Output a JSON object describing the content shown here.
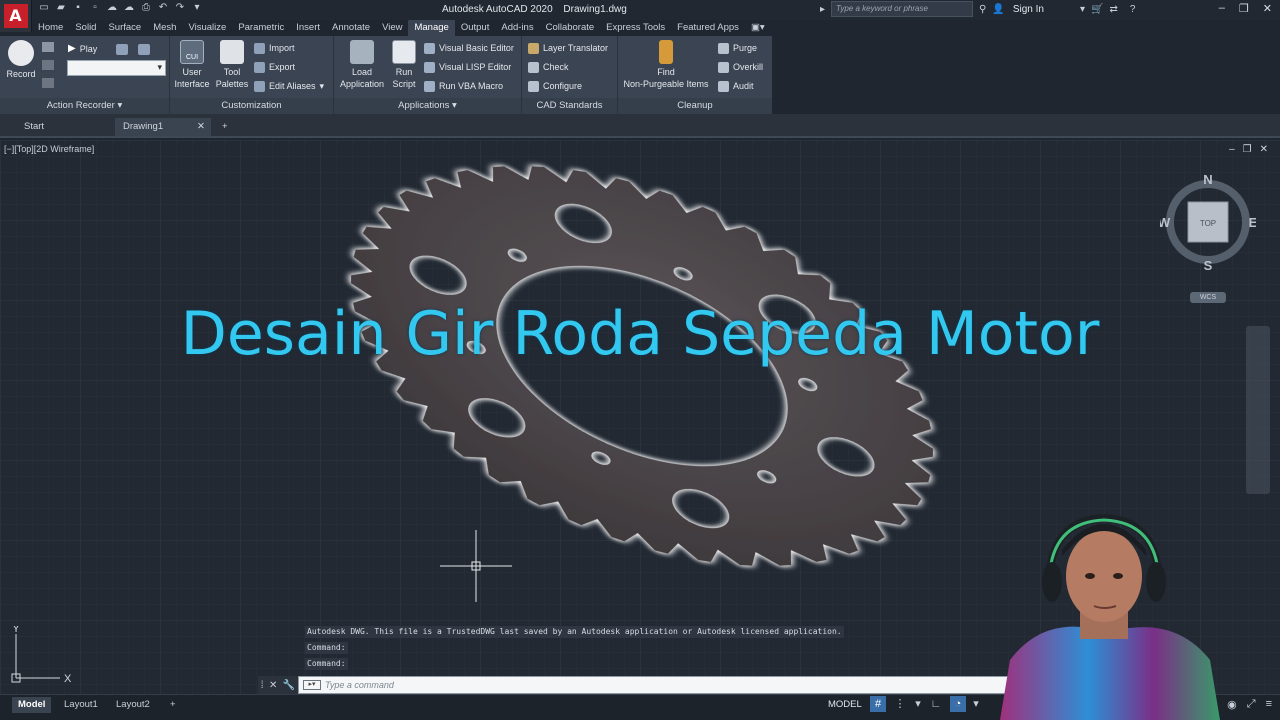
{
  "titlebar": {
    "app_name": "Autodesk AutoCAD 2020",
    "file_name": "Drawing1.dwg",
    "search_placeholder": "Type a keyword or phrase",
    "signin_label": "Sign In",
    "logo_letter": "A"
  },
  "ribbon_tabs": [
    "Home",
    "Solid",
    "Surface",
    "Mesh",
    "Visualize",
    "Parametric",
    "Insert",
    "Annotate",
    "View",
    "Manage",
    "Output",
    "Add-ins",
    "Collaborate",
    "Express Tools",
    "Featured Apps"
  ],
  "active_tab": "Manage",
  "ribbon": {
    "action_recorder": {
      "title": "Action Recorder",
      "record": "Record",
      "play": "Play"
    },
    "customization": {
      "title": "Customization",
      "user_interface": [
        "User",
        "Interface"
      ],
      "tool_palettes": [
        "Tool",
        "Palettes"
      ],
      "import": "Import",
      "export": "Export",
      "edit_aliases": "Edit Aliases"
    },
    "applications": {
      "title": "Applications",
      "load_application": [
        "Load",
        "Application"
      ],
      "run_script": [
        "Run",
        "Script"
      ],
      "visual_basic_editor": "Visual Basic Editor",
      "visual_lisp_editor": "Visual LISP Editor",
      "run_vba_macro": "Run VBA Macro"
    },
    "cad_standards": {
      "title": "CAD Standards",
      "layer_translator": "Layer Translator",
      "check": "Check",
      "configure": "Configure"
    },
    "cleanup": {
      "title": "Cleanup",
      "find_non_purgeable": [
        "Find",
        "Non-Purgeable Items"
      ],
      "purge": "Purge",
      "overkill": "Overkill",
      "audit": "Audit"
    }
  },
  "file_tabs": {
    "start": "Start",
    "drawing": "Drawing1",
    "add": "+"
  },
  "viewport": {
    "label": "[−][Top][2D Wireframe]",
    "viewcube_face": "TOP",
    "compass": {
      "n": "N",
      "s": "S",
      "e": "E",
      "w": "W"
    },
    "wcs": "WCS"
  },
  "headline": "Desain Gir Roda Sepeda Motor",
  "ucs": {
    "x": "X",
    "y": "Y"
  },
  "command_history": [
    "Autodesk DWG.  This file is a TrustedDWG last saved by an Autodesk application or Autodesk licensed application.",
    "Command:",
    "Command:"
  ],
  "command_line": {
    "placeholder": "Type a command"
  },
  "status": {
    "layout_tabs": [
      "Model",
      "Layout1",
      "Layout2"
    ],
    "add": "+",
    "model_label": "MODEL"
  },
  "colors": {
    "headline": "#33c8f0",
    "gear": "#4a4347",
    "active_tab": "#3b4452"
  }
}
